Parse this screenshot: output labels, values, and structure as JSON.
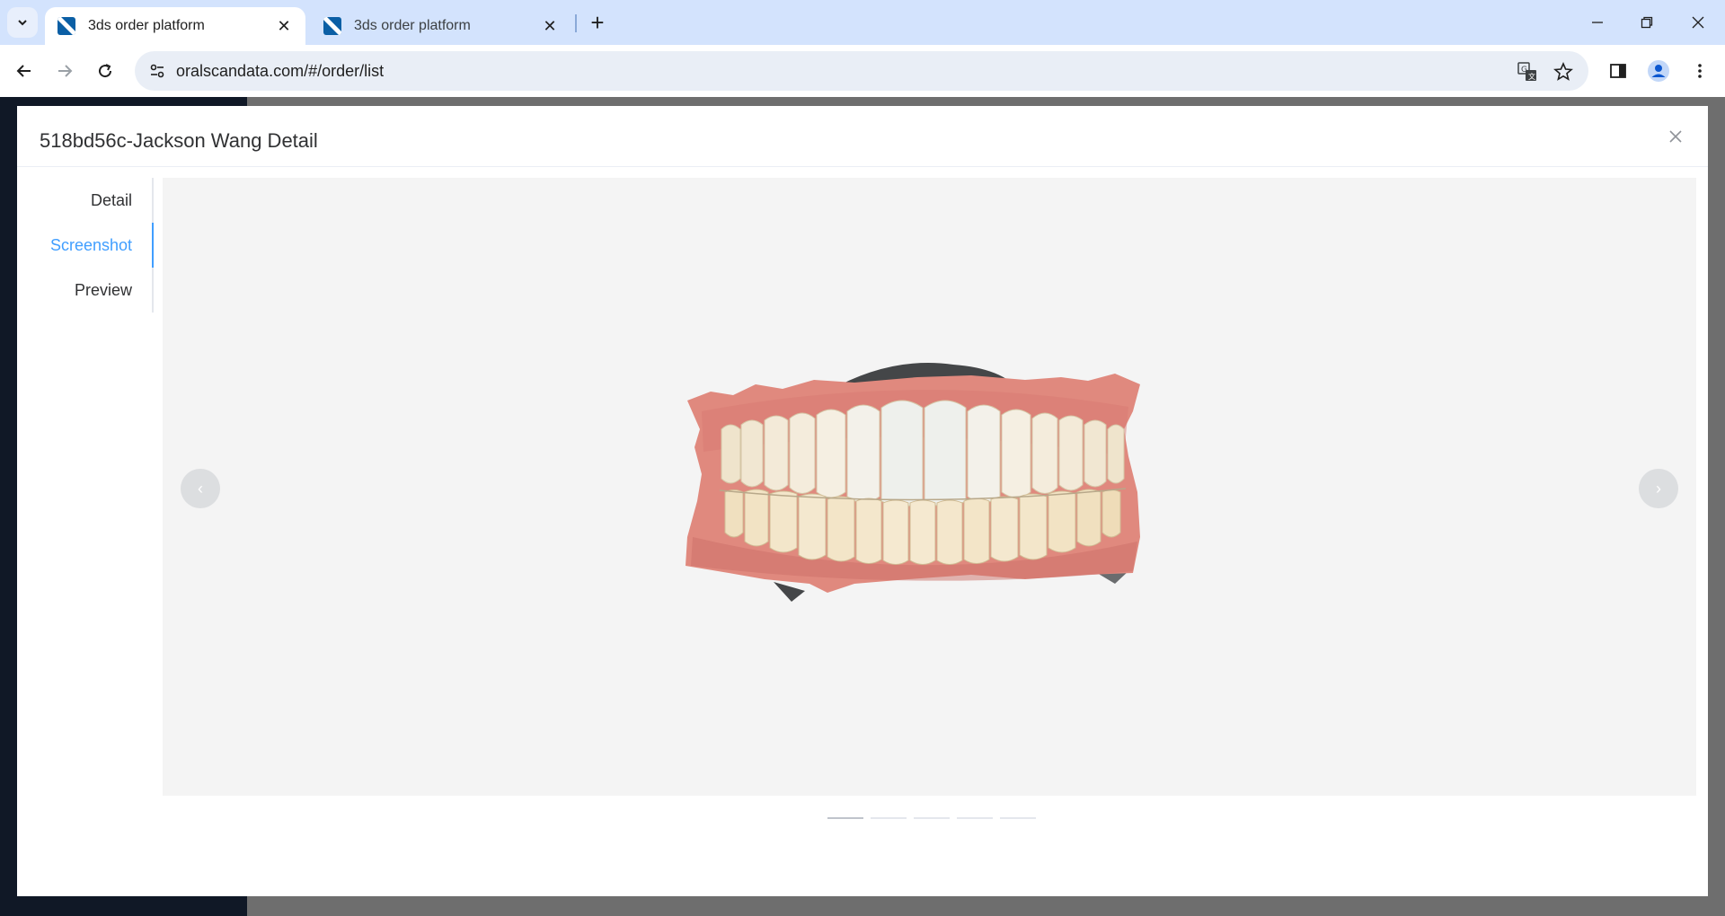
{
  "browser": {
    "tabs": [
      {
        "title": "3ds order platform",
        "active": true
      },
      {
        "title": "3ds order platform",
        "active": false
      }
    ],
    "url": "oralscandata.com/#/order/list"
  },
  "modal": {
    "title": "518bd56c-Jackson Wang Detail",
    "side_tabs": [
      {
        "label": "Detail",
        "active": false
      },
      {
        "label": "Screenshot",
        "active": true
      },
      {
        "label": "Preview",
        "active": false
      }
    ],
    "carousel": {
      "prev_icon": "‹",
      "next_icon": "›",
      "indicator_count": 5,
      "active_indicator": 1,
      "image": "dental-scan-3d-model"
    }
  },
  "colors": {
    "accent": "#409eff",
    "tabstrip": "#d3e3fd",
    "sidebar_dark": "#101826"
  }
}
